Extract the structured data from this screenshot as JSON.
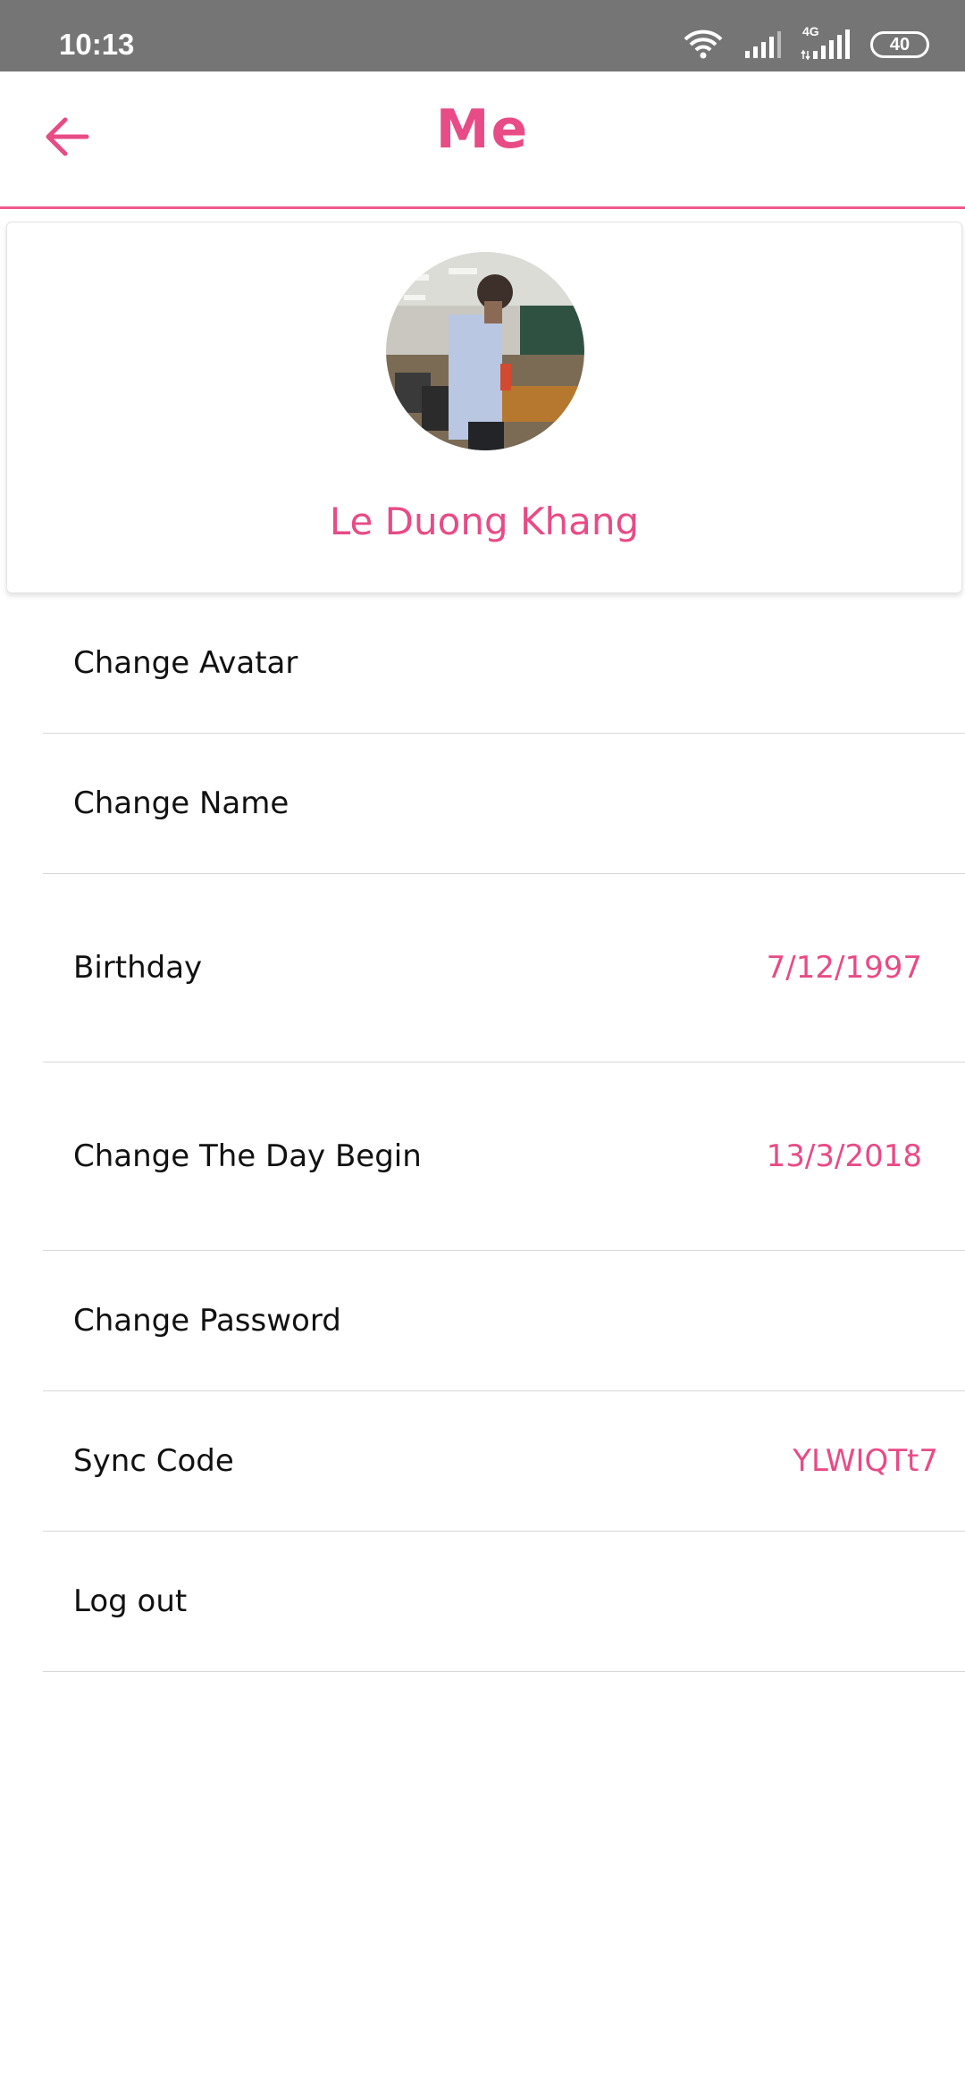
{
  "status_bar": {
    "time": "10:13",
    "network_label": "4G",
    "battery": "40",
    "icons": [
      "wifi-icon",
      "signal-icon",
      "signal-4g-icon",
      "battery-icon"
    ]
  },
  "app_bar": {
    "title": "Me",
    "back_icon": "arrow-left-icon"
  },
  "profile": {
    "name": "Le Duong Khang",
    "avatar": "profile-photo"
  },
  "menu": {
    "items": [
      {
        "label": "Change Avatar",
        "value": ""
      },
      {
        "label": "Change Name",
        "value": ""
      },
      {
        "label": "Birthday",
        "value": "7/12/1997"
      },
      {
        "label": "Change The Day Begin",
        "value": "13/3/2018"
      },
      {
        "label": "Change Password",
        "value": ""
      },
      {
        "label": "Sync Code",
        "value": "YLWIQTt7"
      },
      {
        "label": "Log out",
        "value": ""
      }
    ]
  },
  "colors": {
    "accent": "#e84b86",
    "status_bar": "#757575",
    "divider": "#d8d8d8",
    "text": "#111111"
  }
}
